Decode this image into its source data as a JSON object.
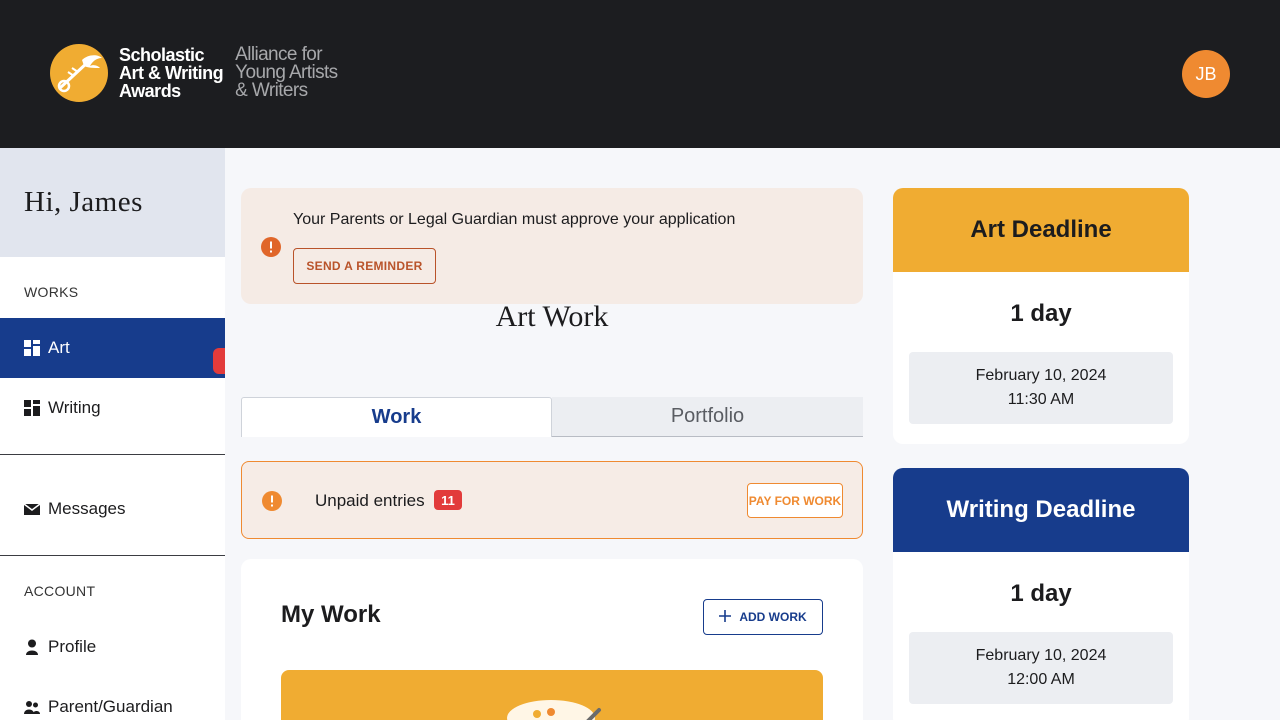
{
  "header": {
    "logo_primary_lines": [
      "Scholastic",
      "Art & Writing",
      "Awards"
    ],
    "logo_secondary_lines": [
      "Alliance for",
      "Young Artists",
      "& Writers"
    ],
    "avatar_initials": "JB"
  },
  "sidebar": {
    "greeting": "Hi, James",
    "works_label": "WORKS",
    "works_items": [
      {
        "label": "Art",
        "icon": "grid-icon",
        "active": true
      },
      {
        "label": "Writing",
        "icon": "grid-icon",
        "active": false
      }
    ],
    "messages_label": "Messages",
    "account_label": "ACCOUNT",
    "account_items": [
      {
        "label": "Profile",
        "icon": "person-icon"
      },
      {
        "label": "Parent/Guardian",
        "icon": "people-icon"
      }
    ]
  },
  "guardian_banner": {
    "message": "Your Parents or Legal Guardian must approve your application",
    "button_label": "SEND A REMINDER"
  },
  "page_title": "Art Work",
  "tabs": [
    {
      "label": "Work",
      "selected": true
    },
    {
      "label": "Portfolio",
      "selected": false
    }
  ],
  "unpaid_banner": {
    "label": "Unpaid entries",
    "count": "11",
    "button_label": "PAY FOR WORK"
  },
  "my_work": {
    "title": "My Work",
    "add_button_label": "ADD WORK"
  },
  "deadlines": [
    {
      "title": "Art Deadline",
      "remaining": "1 day",
      "date": "February 10, 2024",
      "time": "11:30 AM"
    },
    {
      "title": "Writing Deadline",
      "remaining": "1 day",
      "date": "February 10, 2024",
      "time": "12:00 AM"
    }
  ],
  "colors": {
    "header_bg": "#1c1d20",
    "accent_blue": "#173c8c",
    "accent_gold": "#f0ac32",
    "accent_orange": "#ef8a31",
    "badge_red": "#e23b3b"
  }
}
